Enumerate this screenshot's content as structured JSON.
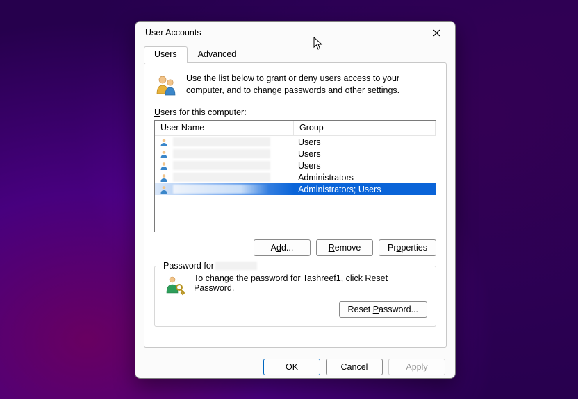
{
  "window": {
    "title": "User Accounts"
  },
  "tabs": {
    "users": "Users",
    "advanced": "Advanced"
  },
  "info": "Use the list below to grant or deny users access to your computer, and to change passwords and other settings.",
  "users_label_pre": "U",
  "users_label_post": "sers for this computer:",
  "columns": {
    "name": "User Name",
    "group": "Group"
  },
  "rows": [
    {
      "group": "Users"
    },
    {
      "group": "Users"
    },
    {
      "group": "Users"
    },
    {
      "group": "Administrators"
    },
    {
      "group": "Administrators; Users",
      "selected": true
    }
  ],
  "buttons": {
    "add": "Add...",
    "remove": "Remove",
    "properties": "Properties",
    "reset": "Reset Password...",
    "ok": "OK",
    "cancel": "Cancel",
    "apply": "Apply"
  },
  "pw_section": {
    "legend": "Password for ",
    "text": "To change the password for Tashreef1, click Reset Password."
  },
  "letters": {
    "d": "d",
    "R": "R",
    "P": "P",
    "A": "A"
  }
}
